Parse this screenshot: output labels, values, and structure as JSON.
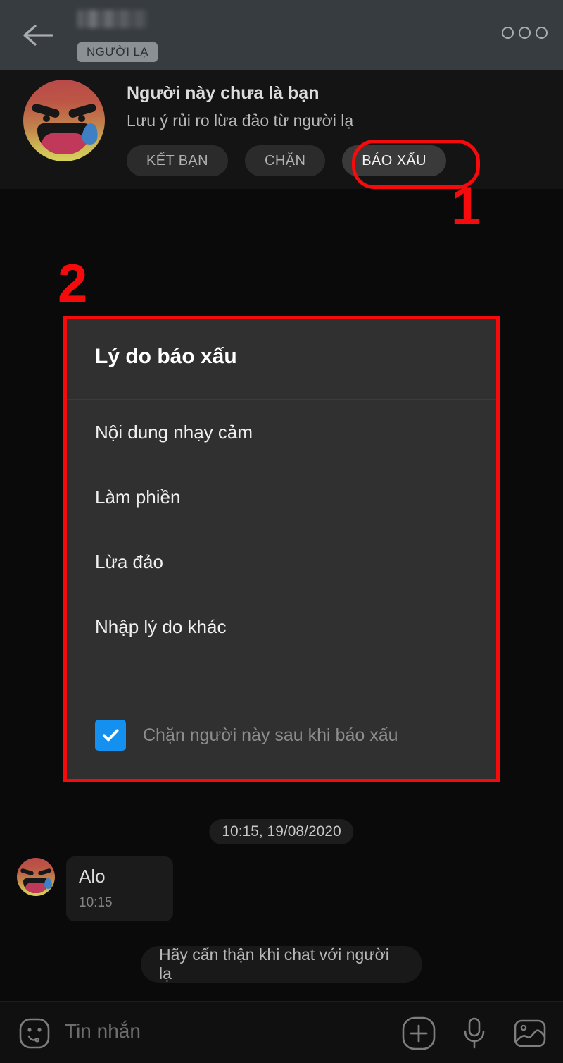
{
  "appbar": {
    "back_icon": "back-arrow-icon",
    "contact_name": "",
    "stranger_badge": "NGƯỜI LẠ",
    "more_icon": "more-options-icon"
  },
  "banner": {
    "avatar": "angry-crying-emoji-avatar",
    "title": "Người này chưa là bạn",
    "subtitle": "Lưu ý rủi ro lừa đảo từ người lạ",
    "actions": [
      {
        "label": "KẾT BẠN",
        "name": "add-friend-button",
        "emphasis": false
      },
      {
        "label": "CHẶN",
        "name": "block-button",
        "emphasis": false
      },
      {
        "label": "BÁO XẤU",
        "name": "report-button",
        "emphasis": true
      }
    ]
  },
  "markers": {
    "one": "1",
    "two": "2"
  },
  "dialog": {
    "title": "Lý do báo xấu",
    "options": [
      "Nội dung nhạy cảm",
      "Làm phiền",
      "Lừa đảo",
      "Nhập lý do khác"
    ],
    "checkbox_label": "Chặn người này sau khi báo xấu",
    "checkbox_checked": "true"
  },
  "chat": {
    "date_chip": "10:15, 19/08/2020",
    "incoming_message": {
      "text": "Alo",
      "time": "10:15"
    },
    "system_notice": "Hãy cẩn thận khi chat với người lạ"
  },
  "inputbar": {
    "emoji_icon": "emoji-sticker-icon",
    "placeholder": "Tin nhắn",
    "plus_icon": "add-attachment-icon",
    "mic_icon": "microphone-icon",
    "image_icon": "photo-gallery-icon"
  },
  "colors": {
    "accent_red": "#f50b0b",
    "checkbox_blue": "#1490f0",
    "appbar_bg": "#373c41",
    "dialog_bg": "#303030",
    "screen_bg": "#0a0a0a"
  }
}
